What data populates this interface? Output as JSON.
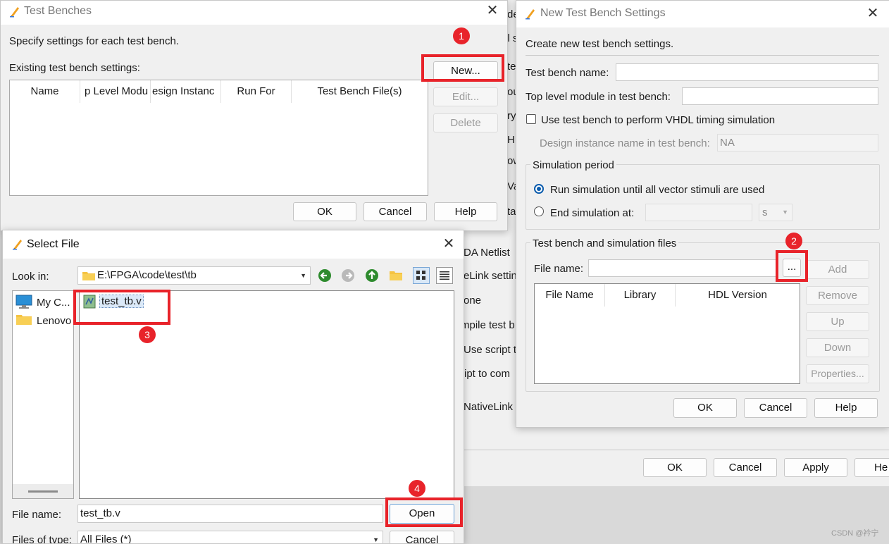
{
  "background": {
    "fragments": [
      "de",
      "el s",
      "te",
      "ou",
      "ry",
      "HI",
      "ow",
      "Va",
      "ta",
      "DA Netlist",
      "eLink setting",
      "one",
      "mpile test b",
      "Use script t",
      "ript to com",
      "NativeLink S"
    ],
    "buttons": {
      "ok": "OK",
      "cancel": "Cancel",
      "apply": "Apply",
      "help": "He"
    }
  },
  "testbenches": {
    "title": "Test Benches",
    "description": "Specify settings for each test bench.",
    "existing_label": "Existing test bench settings:",
    "columns": [
      "Name",
      "p Level Modu",
      "esign Instanc",
      "Run For",
      "Test Bench File(s)"
    ],
    "buttons": {
      "new": "New...",
      "edit": "Edit...",
      "delete": "Delete",
      "ok": "OK",
      "cancel": "Cancel",
      "help": "Help"
    }
  },
  "newbench": {
    "title": "New Test Bench Settings",
    "description": "Create new test bench settings.",
    "name_label": "Test bench name:",
    "name_value": "",
    "top_label": "Top level module in test bench:",
    "top_value": "",
    "vhdl_checkbox": "Use test bench to perform VHDL timing simulation",
    "instance_label": "Design instance name in test bench:",
    "instance_value": "NA",
    "sim_period_title": "Simulation period",
    "radio_run_all": "Run simulation until all vector stimuli are used",
    "radio_end_at": "End simulation at:",
    "end_unit": "s",
    "files_title": "Test bench and simulation files",
    "file_name_label": "File name:",
    "file_name_value": "",
    "browse": "...",
    "columns": [
      "File Name",
      "Library",
      "HDL Version"
    ],
    "buttons": {
      "add": "Add",
      "remove": "Remove",
      "up": "Up",
      "down": "Down",
      "properties": "Properties...",
      "ok": "OK",
      "cancel": "Cancel",
      "help": "Help"
    }
  },
  "selectfile": {
    "title": "Select File",
    "look_in_label": "Look in:",
    "look_in_value": "E:\\FPGA\\code\\test\\tb",
    "sidebar": [
      "My C...",
      "Lenovo"
    ],
    "files": [
      "test_tb.v"
    ],
    "file_name_label": "File name:",
    "file_name_value": "test_tb.v",
    "files_of_type_label": "Files of type:",
    "files_of_type_value": "All Files (*)",
    "buttons": {
      "open": "Open",
      "cancel": "Cancel"
    }
  },
  "steps": [
    "1",
    "2",
    "3",
    "4"
  ],
  "watermark": "CSDN @衿宁",
  "colors": {
    "annotation_red": "#e8232a",
    "radio_blue": "#0b5cad",
    "nav_green": "#2e8b2e"
  }
}
